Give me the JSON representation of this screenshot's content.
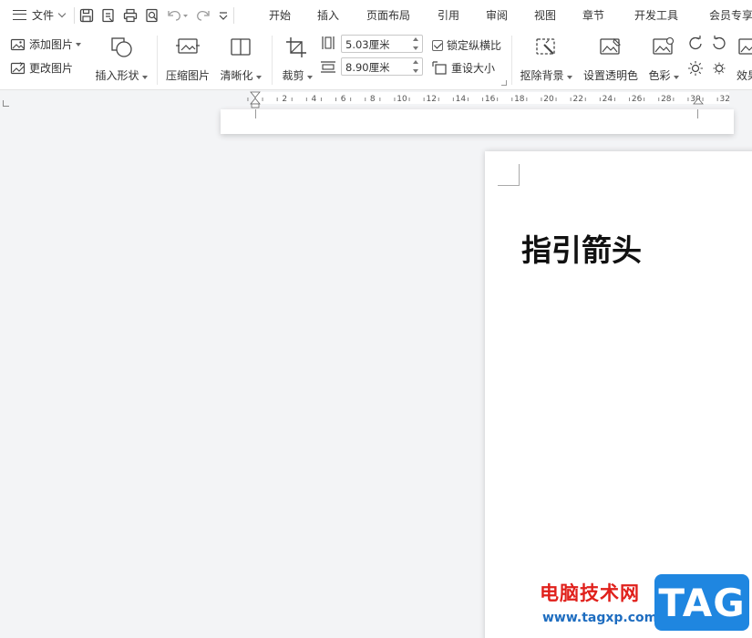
{
  "menubar": {
    "file_label": "文件",
    "tabs": [
      "开始",
      "插入",
      "页面布局",
      "引用",
      "审阅",
      "视图",
      "章节",
      "开发工具",
      "会员专享"
    ]
  },
  "ribbon": {
    "add_image": "添加图片",
    "change_image": "更改图片",
    "insert_shape": "插入形状",
    "compress_image": "压缩图片",
    "sharpen": "清晰化",
    "crop": "裁剪",
    "height_value": "5.03厘米",
    "width_value": "8.90厘米",
    "lock_ratio": "锁定纵横比",
    "reset_size": "重设大小",
    "remove_bg": "抠除背景",
    "set_transparent": "设置透明色",
    "color": "色彩",
    "effects": "效果"
  },
  "ruler": {
    "labels": [
      "2",
      "4",
      "6",
      "8",
      "10",
      "12",
      "14",
      "16",
      "18",
      "20",
      "22",
      "24",
      "26",
      "28",
      "30",
      "32"
    ]
  },
  "document": {
    "title": "指引箭头"
  },
  "watermark": {
    "site_name": "电脑技术网",
    "url": "www.tagxp.com",
    "badge": "TAG"
  },
  "colors": {
    "watermark_red": "#e0201b",
    "watermark_blue": "#1f86e0"
  }
}
